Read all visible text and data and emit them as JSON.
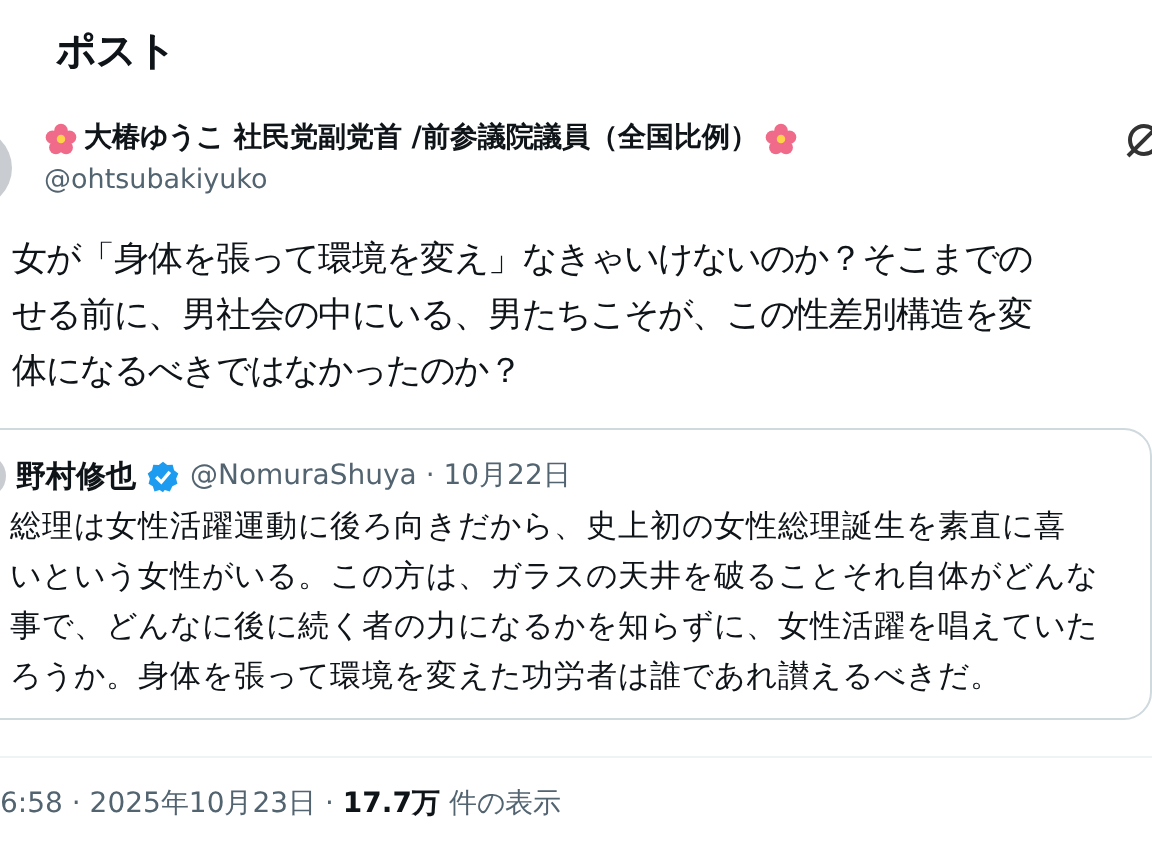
{
  "header": {
    "title": "ポスト"
  },
  "post": {
    "author": {
      "name": "大椿ゆうこ 社民党副党首 /前参議院議員（全国比例）",
      "handle": "@ohtsubakiyuko"
    },
    "lines": [
      "女が「身体を張って環境を変え」なきゃいけないのか？そこまでの",
      "せる前に、男社会の中にいる、男たちこそが、この性差別構造を変",
      "体になるべきではなかったのか？"
    ],
    "quote": {
      "author": {
        "name": "野村修也",
        "verified": true,
        "byline": "@NomuraShuya · 10月22日"
      },
      "lines": [
        "総理は女性活躍運動に後ろ向きだから、史上初の女性総理誕生を素直に喜",
        "いという女性がいる。この方は、ガラスの天井を破ることそれ自体がどんな",
        "事で、どんなに後に続く者の力になるかを知らずに、女性活躍を唱えていた",
        "ろうか。身体を張って環境を変えた功労者は誰であれ讃えるべきだ。"
      ]
    },
    "meta": "6:58 · 2025年10月23日 · **17.7万** 件の表示"
  }
}
